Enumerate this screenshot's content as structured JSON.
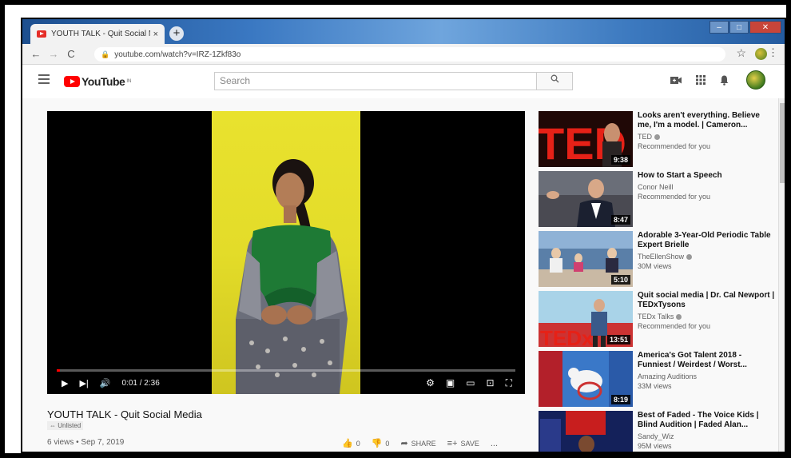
{
  "browser": {
    "tab_title": "YOUTH TALK - Quit Social Media",
    "tab_close": "×",
    "new_tab": "+",
    "url": "youtube.com/watch?v=IRZ-1Zkf83o"
  },
  "header": {
    "logo_text": "YouTube",
    "logo_region": "IN",
    "search_placeholder": "Search"
  },
  "player": {
    "time": "0:01 / 2:36",
    "progress": 0.007
  },
  "video": {
    "title": "YOUTH TALK - Quit Social Media",
    "badge": "Unlisted",
    "meta": "6 views • Sep 7, 2019",
    "likes": "0",
    "dislikes": "0",
    "share_label": "SHARE",
    "save_label": "SAVE",
    "more": "..."
  },
  "recommendations": [
    {
      "title": "Looks aren't everything. Believe me, I'm a model. | Cameron...",
      "channel": "TED",
      "verified": true,
      "sub": "Recommended for you",
      "duration": "9:38"
    },
    {
      "title": "How to Start a Speech",
      "channel": "Conor Neill",
      "verified": false,
      "sub": "Recommended for you",
      "duration": "8:47"
    },
    {
      "title": "Adorable 3-Year-Old Periodic Table Expert Brielle",
      "channel": "TheEllenShow",
      "verified": true,
      "sub": "30M views",
      "duration": "5:10"
    },
    {
      "title": "Quit social media | Dr. Cal Newport | TEDxTysons",
      "channel": "TEDx Talks",
      "verified": true,
      "sub": "Recommended for you",
      "duration": "13:51"
    },
    {
      "title": "America's Got Talent 2018 - Funniest / Weirdest / Worst...",
      "channel": "Amazing Auditions",
      "verified": false,
      "sub": "33M views",
      "duration": "8:19"
    },
    {
      "title": "Best of Faded - The Voice Kids | Blind Audition | Faded Alan...",
      "channel": "Sandy_Wiz",
      "verified": false,
      "sub": "95M views",
      "duration": ""
    }
  ]
}
